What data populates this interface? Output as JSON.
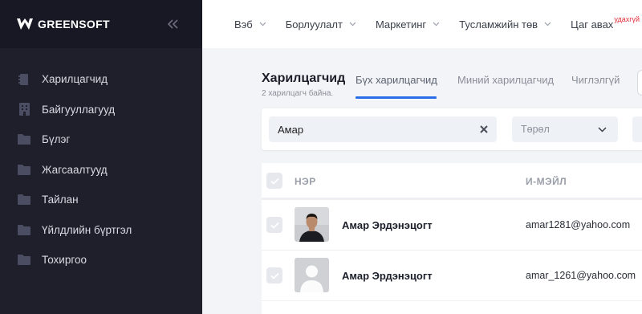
{
  "brand": {
    "name": "GREENSOFT"
  },
  "sidebar": {
    "items": [
      {
        "label": "Харилцагчид",
        "icon": "contact-book-icon"
      },
      {
        "label": "Байгууллагууд",
        "icon": "building-icon"
      },
      {
        "label": "Бүлэг",
        "icon": "folder-icon"
      },
      {
        "label": "Жагсаалтууд",
        "icon": "folder-icon"
      },
      {
        "label": "Тайлан",
        "icon": "folder-icon"
      },
      {
        "label": "Үйлдлийн бүртгэл",
        "icon": "folder-icon"
      },
      {
        "label": "Тохиргоо",
        "icon": "folder-icon"
      }
    ]
  },
  "topnav": {
    "items": [
      {
        "label": "Вэб"
      },
      {
        "label": "Борлуулалт"
      },
      {
        "label": "Маркетинг"
      },
      {
        "label": "Тусламжийн төв"
      },
      {
        "label": "Цаг авах",
        "badge": "удахгүй"
      }
    ]
  },
  "page": {
    "title": "Харилцагчид",
    "subtitle": "2 харилцагч байна.",
    "tabs": [
      {
        "label": "Бүх харилцагчид",
        "active": true
      },
      {
        "label": "Миний харилцагчид",
        "active": false
      },
      {
        "label": "Чиглэлгүй",
        "active": false
      }
    ]
  },
  "filters": {
    "search_value": "Амар",
    "type_placeholder": "Төрөл"
  },
  "table": {
    "headers": {
      "name": "НЭР",
      "email": "И-МЭЙЛ"
    },
    "rows": [
      {
        "name": "Амар Эрдэнэцогт",
        "email": "amar1281@yahoo.com",
        "avatar": "photo"
      },
      {
        "name": "Амар Эрдэнэцогт",
        "email": "amar_1261@yahoo.com",
        "avatar": "placeholder"
      }
    ]
  },
  "colors": {
    "sidebar_bg": "#1f1f2b",
    "accent": "#2a6de8",
    "badge": "#e2303a"
  }
}
